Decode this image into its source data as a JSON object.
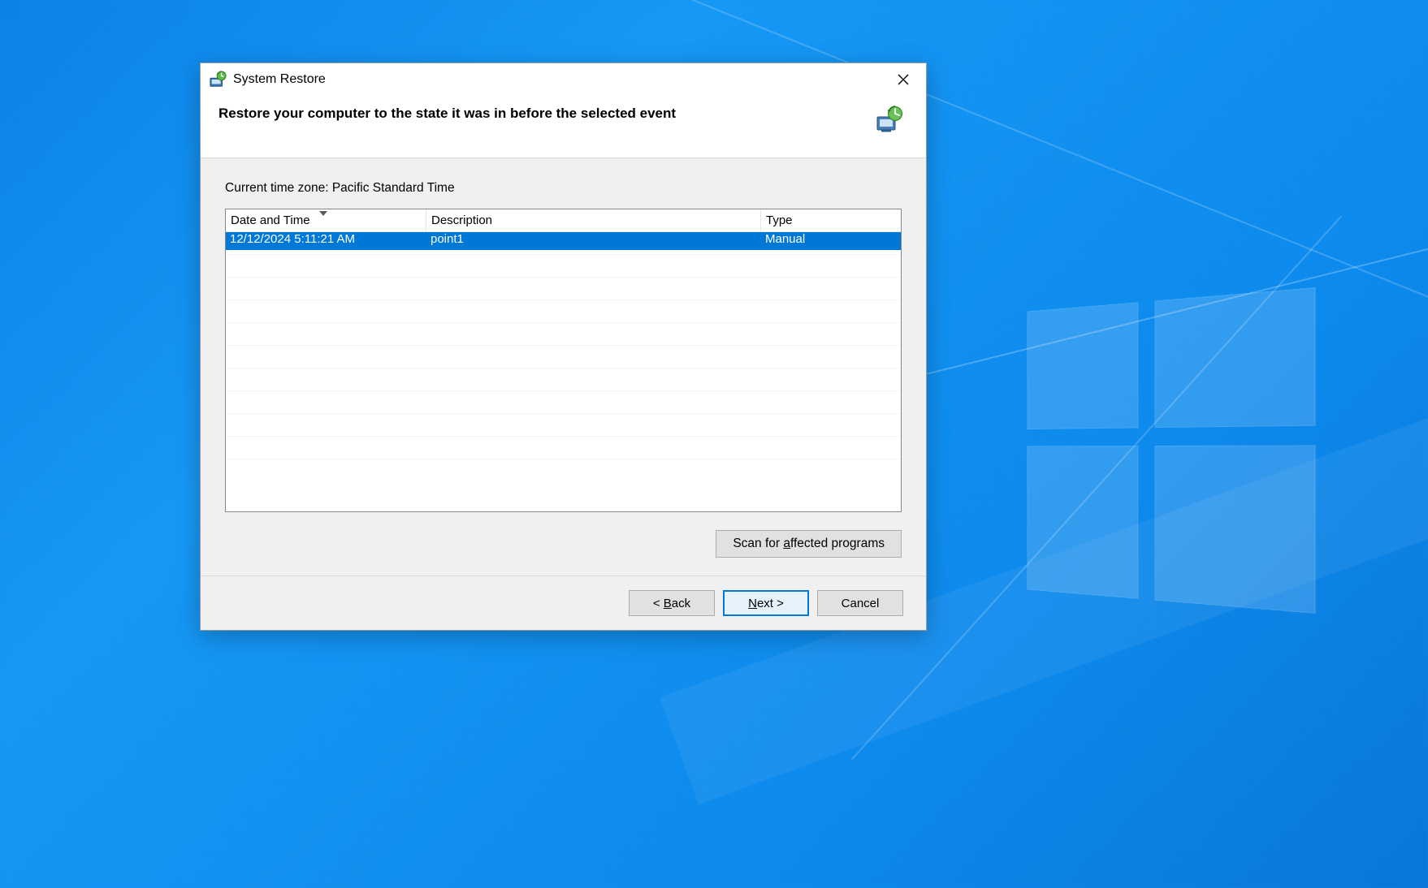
{
  "window": {
    "title": "System Restore"
  },
  "header": {
    "heading": "Restore your computer to the state it was in before the selected event"
  },
  "content": {
    "timezone_prefix": "Current time zone: ",
    "timezone_value": "Pacific Standard Time"
  },
  "table": {
    "columns": {
      "date": "Date and Time",
      "description": "Description",
      "type": "Type"
    },
    "sorted_column": "date",
    "rows": [
      {
        "date": "12/12/2024 5:11:21 AM",
        "description": "point1",
        "type": "Manual",
        "selected": true
      }
    ]
  },
  "buttons": {
    "scan_prefix": "Scan for ",
    "scan_accel": "a",
    "scan_suffix": "ffected programs",
    "back_prefix": "< ",
    "back_accel": "B",
    "back_suffix": "ack",
    "next_accel": "N",
    "next_suffix": "ext >",
    "cancel": "Cancel"
  }
}
